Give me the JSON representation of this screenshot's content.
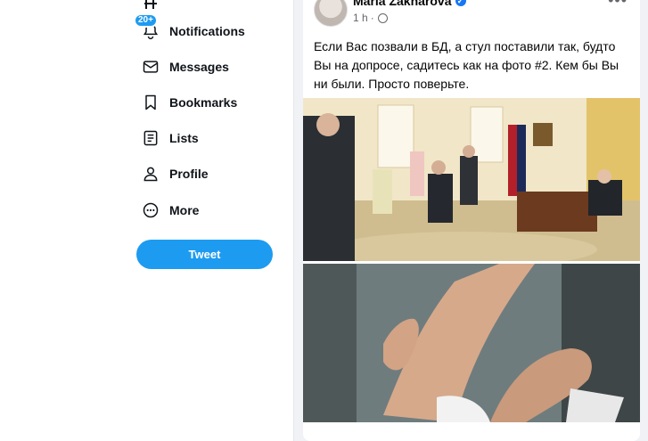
{
  "nav": {
    "items": [
      {
        "label": "Notifications",
        "icon": "bell-icon",
        "badge": "20+"
      },
      {
        "label": "Messages",
        "icon": "envelope-icon"
      },
      {
        "label": "Bookmarks",
        "icon": "bookmark-icon"
      },
      {
        "label": "Lists",
        "icon": "list-icon"
      },
      {
        "label": "Profile",
        "icon": "person-icon"
      },
      {
        "label": "More",
        "icon": "more-circle-icon"
      }
    ],
    "tweet_label": "Tweet",
    "accent": "#1d9bf0"
  },
  "post": {
    "author": "Maria Zakharova",
    "time": "1 h",
    "text": "Если Вас позвали в БД, а стул поставили так, будто Вы на допросе, садитесь как на фото #2. Кем бы Вы ни были. Просто поверьте.",
    "verified_color": "#1877f2"
  }
}
